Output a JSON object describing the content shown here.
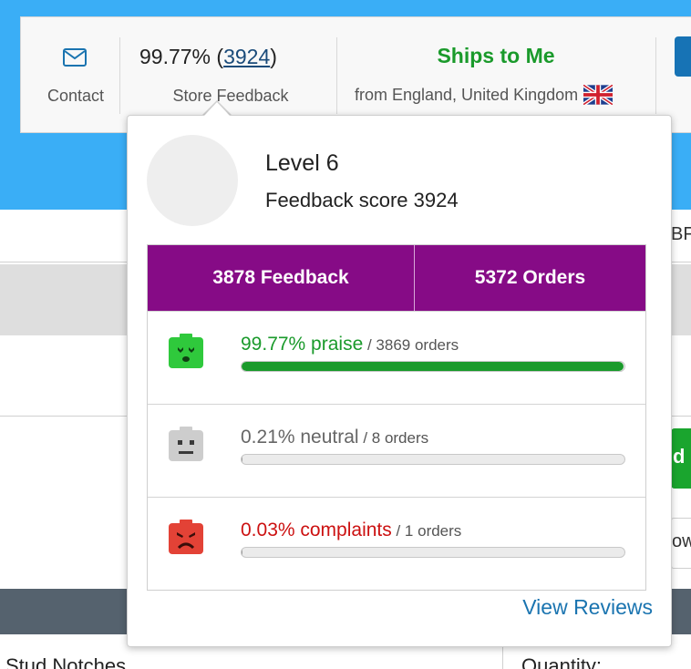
{
  "store_bar": {
    "contact_label": "Contact",
    "feedback_percent": "99.77%",
    "feedback_count": "3924",
    "feedback_label": "Store Feedback",
    "ships_title": "Ships to Me",
    "ships_from": "from England, United Kingdom"
  },
  "background": {
    "right_text": "BF",
    "green_button_text": "d",
    "input_text": "ow",
    "bottom_left_text": "Stud Notches",
    "bottom_right_text": "Quantity:"
  },
  "popover": {
    "level": "Level 6",
    "feedback_score": "Feedback score 3924",
    "tabs": [
      {
        "label": "3878 Feedback"
      },
      {
        "label": "5372 Orders"
      }
    ],
    "rows": [
      {
        "label": "99.77% praise",
        "orders": " / 3869 orders",
        "fraction": 0.9977,
        "color": "#1a9a2b",
        "icon": "praise-face-icon"
      },
      {
        "label": "0.21% neutral",
        "orders": " / 8 orders",
        "fraction": 0.0021,
        "color": "#666666",
        "icon": "neutral-face-icon"
      },
      {
        "label": "0.03% complaints",
        "orders": " / 1 orders",
        "fraction": 0.0003,
        "color": "#cc1111",
        "icon": "complaint-face-icon"
      }
    ],
    "view_reviews": "View Reviews"
  },
  "colors": {
    "top_band": "#3aaef6",
    "tabs_bg": "#860b86",
    "praise_green": "#1a9a2b",
    "link_blue": "#1a74b0"
  }
}
